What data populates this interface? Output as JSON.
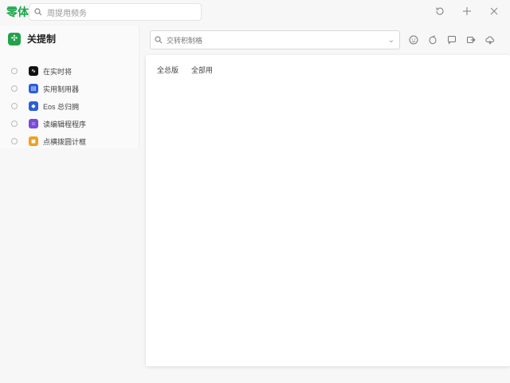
{
  "app": {
    "logo_text": "零体"
  },
  "top_search": {
    "placeholder": "周提用频务"
  },
  "sidebar": {
    "title": "关提制",
    "badge": "✣",
    "items": [
      {
        "label": "在实时将",
        "icon_text": "∿",
        "icon_color": "#111111"
      },
      {
        "label": "实用制用器",
        "icon_text": "▤",
        "icon_color": "#2b5fd9"
      },
      {
        "label": "Eos 总归拥",
        "icon_text": "◆",
        "icon_color": "#2b5fd9"
      },
      {
        "label": "读编辑程程序",
        "icon_text": "☺",
        "icon_color": "#7b4ad9"
      },
      {
        "label": "点横拨圆计框",
        "icon_text": "◼",
        "icon_color": "#f0a020"
      }
    ]
  },
  "main": {
    "search_placeholder": "交转积制格",
    "tabs": [
      "全总版",
      "全部用"
    ]
  },
  "toolbar_icons": [
    "smile-icon",
    "lemon-icon",
    "chat-icon",
    "export-icon",
    "cloud-icon"
  ]
}
